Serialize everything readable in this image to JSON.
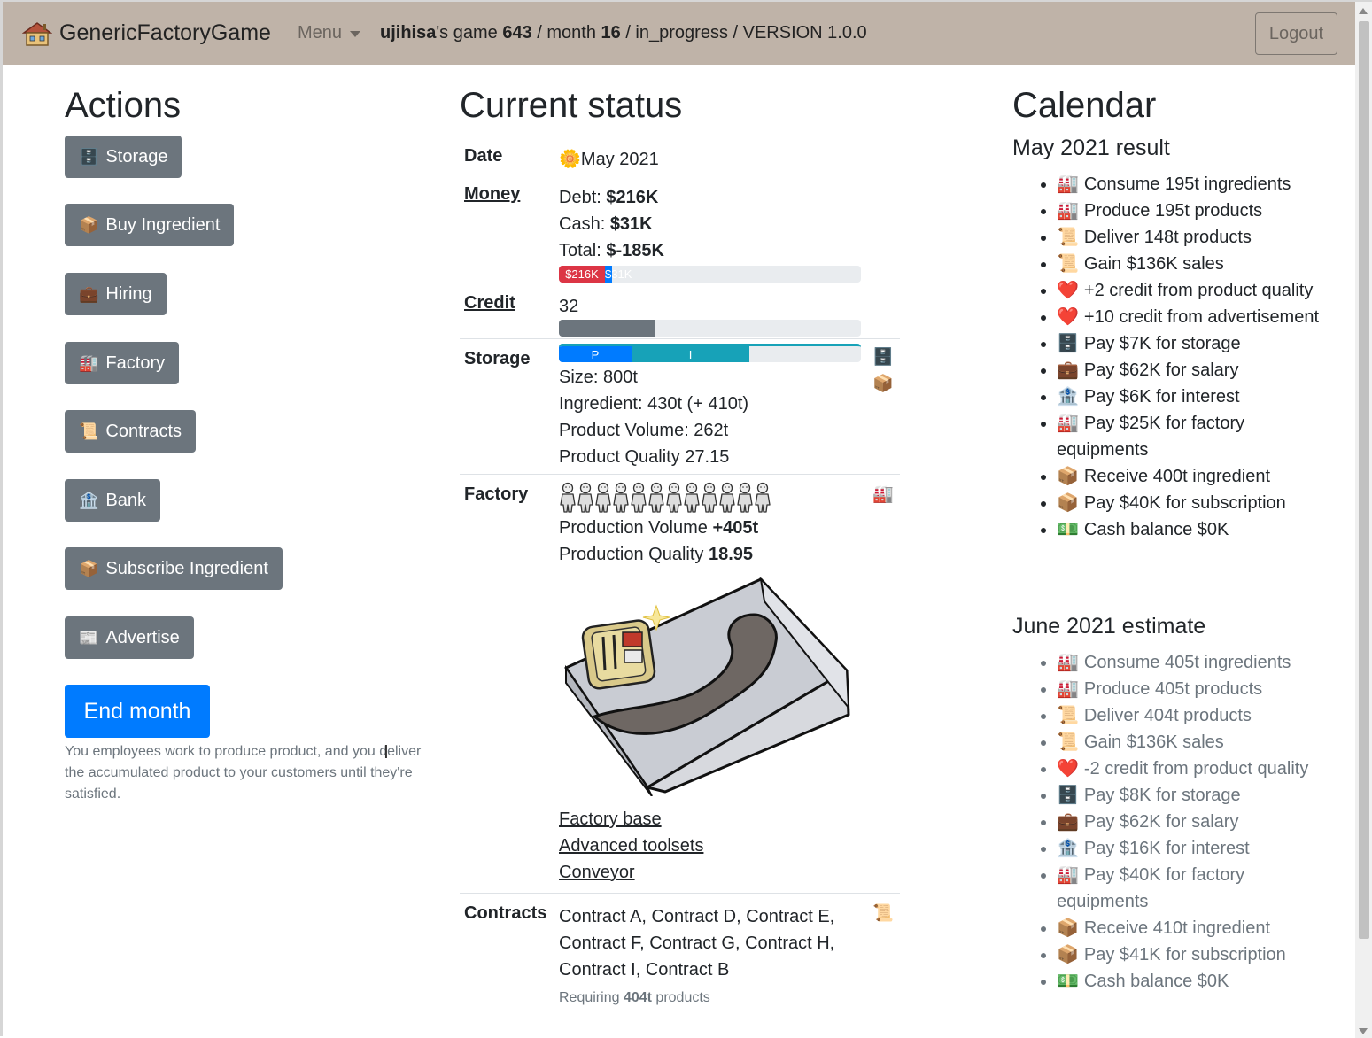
{
  "navbar": {
    "brand": "GenericFactoryGame",
    "menu_label": "Menu",
    "user": "ujihisa",
    "game_text": "'s game ",
    "game_id": "643",
    "month_text": " / month ",
    "month": "16",
    "status_text": " / in_progress / VERSION 1.0.0",
    "logout_label": "Logout"
  },
  "actions": {
    "title": "Actions",
    "buttons": [
      {
        "icon": "🗄️",
        "label": "Storage"
      },
      {
        "icon": "📦",
        "label": "Buy Ingredient"
      },
      {
        "icon": "💼",
        "label": "Hiring"
      },
      {
        "icon": "🏭",
        "label": "Factory"
      },
      {
        "icon": "📜",
        "label": "Contracts"
      },
      {
        "icon": "🏦",
        "label": "Bank"
      },
      {
        "icon": "📦",
        "label": "Subscribe Ingredient"
      },
      {
        "icon": "📰",
        "label": "Advertise"
      }
    ],
    "end_month_label": "End month",
    "help_text": "You employees work to produce product, and you deliver the accumulated product to your customers until they're satisfied."
  },
  "status": {
    "title": "Current status",
    "date": {
      "label": "Date",
      "icon": "🌼",
      "value": "May 2021"
    },
    "money": {
      "label": "Money",
      "debt_label": "Debt: ",
      "debt": "$216K",
      "cash_label": "Cash: ",
      "cash": "$31K",
      "total_label": "Total: ",
      "total": "$-185K",
      "bar_debt_text": "$216K",
      "bar_cash_text": "$31K",
      "bar_debt_fraction": 0.152,
      "bar_cash_fraction": 0.022,
      "debt_color": "#dc3545",
      "cash_color": "#007bff"
    },
    "credit": {
      "label": "Credit",
      "value": "32",
      "fraction": 0.32
    },
    "storage": {
      "label": "Storage",
      "bar_p_text": "P",
      "bar_i_text": "I",
      "bar_p_fraction": 0.24,
      "bar_i_fraction": 0.39,
      "size": "Size: 800t",
      "ingredient": "Ingredient: 430t (+ 410t)",
      "product_volume": "Product Volume: 262t",
      "product_quality": "Product Quality 27.15",
      "icons": [
        "🗄️",
        "📦"
      ]
    },
    "factory": {
      "label": "Factory",
      "worker_count": 12,
      "production_volume_label": "Production Volume ",
      "production_volume": "+405t",
      "production_quality_label": "Production Quality ",
      "production_quality": "18.95",
      "links": [
        "Factory base",
        "Advanced toolsets",
        "Conveyor"
      ],
      "icon": "🏭"
    },
    "contracts": {
      "label": "Contracts",
      "list": "Contract A, Contract D, Contract E, Contract F, Contract G, Contract H, Contract I, Contract B",
      "requiring_prefix": "Requiring ",
      "requiring_value": "404t",
      "requiring_suffix": " products",
      "icon": "📜"
    }
  },
  "calendar": {
    "title": "Calendar",
    "result_title": "May 2021 result",
    "result_items": [
      {
        "icon": "🏭",
        "text": "Consume 195t ingredients"
      },
      {
        "icon": "🏭",
        "text": "Produce 195t products"
      },
      {
        "icon": "📜",
        "text": "Deliver 148t products"
      },
      {
        "icon": "📜",
        "text": "Gain $136K sales"
      },
      {
        "icon": "❤️",
        "text": "+2 credit from product quality"
      },
      {
        "icon": "❤️",
        "text": "+10 credit from advertisement"
      },
      {
        "icon": "🗄️",
        "text": "Pay $7K for storage"
      },
      {
        "icon": "💼",
        "text": "Pay $62K for salary"
      },
      {
        "icon": "🏦",
        "text": "Pay $6K for interest"
      },
      {
        "icon": "🏭",
        "text": "Pay $25K for factory equipments"
      },
      {
        "icon": "📦",
        "text": "Receive 400t ingredient"
      },
      {
        "icon": "📦",
        "text": "Pay $40K for subscription"
      },
      {
        "icon": "💵",
        "text": "Cash balance $0K"
      }
    ],
    "estimate_title": "June 2021 estimate",
    "estimate_items": [
      {
        "icon": "🏭",
        "text": "Consume 405t ingredients"
      },
      {
        "icon": "🏭",
        "text": "Produce 405t products"
      },
      {
        "icon": "📜",
        "text": "Deliver 404t products"
      },
      {
        "icon": "📜",
        "text": "Gain $136K sales"
      },
      {
        "icon": "❤️",
        "text": "-2 credit from product quality"
      },
      {
        "icon": "🗄️",
        "text": "Pay $8K for storage"
      },
      {
        "icon": "💼",
        "text": "Pay $62K for salary"
      },
      {
        "icon": "🏦",
        "text": "Pay $16K for interest"
      },
      {
        "icon": "🏭",
        "text": "Pay $40K for factory equipments"
      },
      {
        "icon": "📦",
        "text": "Receive 410t ingredient"
      },
      {
        "icon": "📦",
        "text": "Pay $41K for subscription"
      },
      {
        "icon": "💵",
        "text": "Cash balance $0K"
      }
    ]
  }
}
